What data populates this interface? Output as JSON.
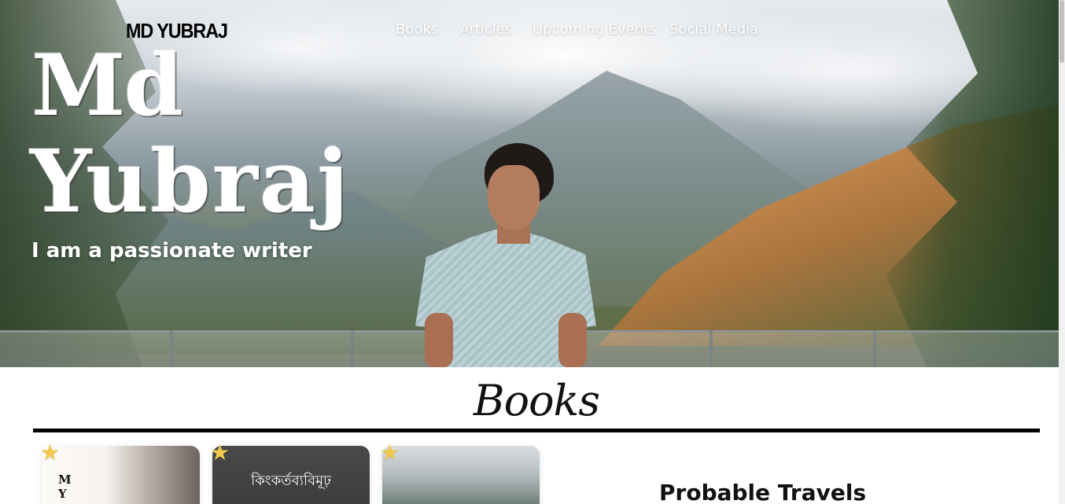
{
  "header": {
    "brand": "MD YUBRAJ",
    "nav": [
      "Books",
      "Articles",
      "Upcoming Events",
      "Social Media"
    ]
  },
  "hero": {
    "name_line1": "Md",
    "name_line2": "Yubraj",
    "tagline": "I am a passionate writer"
  },
  "books": {
    "heading": "Books",
    "cards": [
      {
        "title_text": "MY"
      },
      {
        "title_text": "কিংকর্তব্যবিমূঢ়"
      },
      {
        "title_text": ""
      }
    ],
    "side_title": "Probable Travels"
  },
  "colors": {
    "star": "#f2c94c",
    "rule": "#000000"
  }
}
